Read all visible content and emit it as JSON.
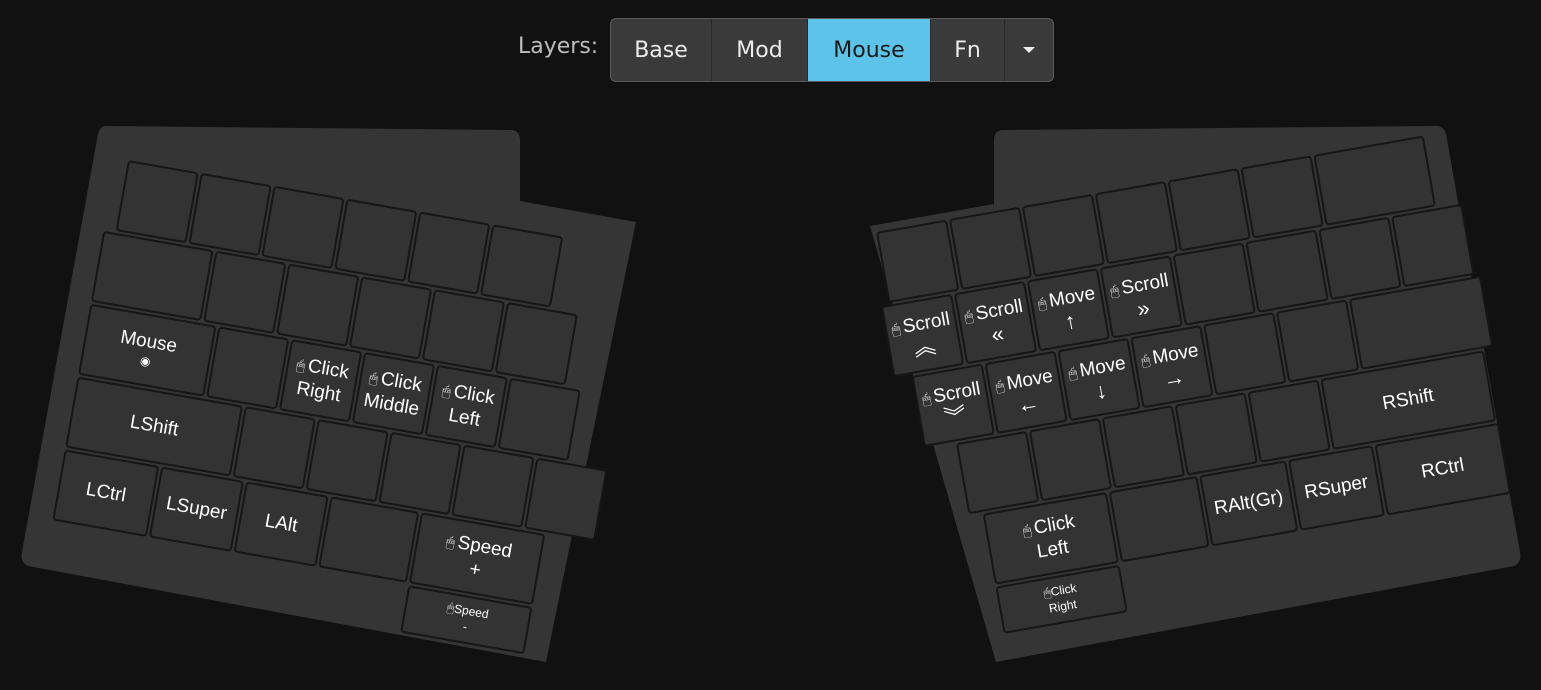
{
  "layers": {
    "label": "Layers:",
    "tabs": [
      "Base",
      "Mod",
      "Mouse",
      "Fn"
    ],
    "active": "Mouse",
    "accent": "#5dc3e8"
  },
  "icons": {
    "mouse": "🖱",
    "wifi": "◉",
    "arrow_up": "↑",
    "arrow_down": "↓",
    "arrow_left": "←",
    "arrow_right": "→",
    "dbl_up": "︽",
    "dbl_down": "︾",
    "dbl_left": "«",
    "dbl_right": "»"
  },
  "left": {
    "mouse_layer": "Mouse",
    "click_right_1": "Click",
    "click_right_2": "Right",
    "click_middle_1": "Click",
    "click_middle_2": "Middle",
    "click_left_1": "Click",
    "click_left_2": "Left",
    "lshift": "LShift",
    "lctrl": "LCtrl",
    "lsuper": "LSuper",
    "lalt": "LAlt",
    "speed_plus_1": "Speed",
    "speed_plus_2": "+",
    "speed_minus_1": "Speed",
    "speed_minus_2": "-"
  },
  "right": {
    "scroll": "Scroll",
    "move": "Move",
    "rshift": "RShift",
    "ralt": "RAlt(Gr)",
    "rsuper": "RSuper",
    "rctrl": "RCtrl",
    "click_left_1": "Click",
    "click_left_2": "Left",
    "click_right_1": "Click",
    "click_right_2": "Right"
  }
}
